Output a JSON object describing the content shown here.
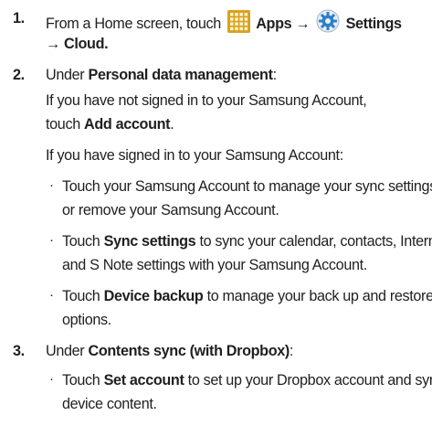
{
  "steps": [
    {
      "number": "1.",
      "text_before_apps": "From a Home screen, touch",
      "apps_label": "Apps",
      "arrow": "→",
      "settings_label": "Settings",
      "cloud_label": "Cloud",
      "apps_icon": "apps-grid-icon",
      "settings_icon": "gear-icon"
    },
    {
      "number": "2.",
      "under": "Under",
      "section": "Personal data management",
      "not_signed_1": "If you have not signed in to your Samsung Account,",
      "not_signed_2": "touch",
      "add_account": "Add account",
      "signed": "If you have signed in to your Samsung Account:",
      "bullet_a_1": "Touch your Samsung Account to manage your sync settings",
      "bullet_a_2": "or remove your Samsung Account.",
      "bullet_b_touch": "Touch",
      "bullet_b_bold": "Sync settings",
      "bullet_b_rest": "to sync your calendar, contacts, Internet,",
      "bullet_b_2": "and S Note settings with your Samsung Account.",
      "bullet_c_touch": "Touch",
      "bullet_c_bold": "Device backup",
      "bullet_c_rest": "to manage your back up and restore",
      "bullet_c_2": "options."
    },
    {
      "number": "3.",
      "under": "Under",
      "section": "Contents sync (with Dropbox)",
      "bullet_a_touch": "Touch",
      "bullet_a_bold": "Set account",
      "bullet_a_rest": "to set up your Dropbox account and sync",
      "bullet_a_2": "device content."
    }
  ],
  "colors": {
    "text": "#1f1f1f",
    "apps_icon": "#d9a11e",
    "settings_icon": "#2f7fc6"
  }
}
